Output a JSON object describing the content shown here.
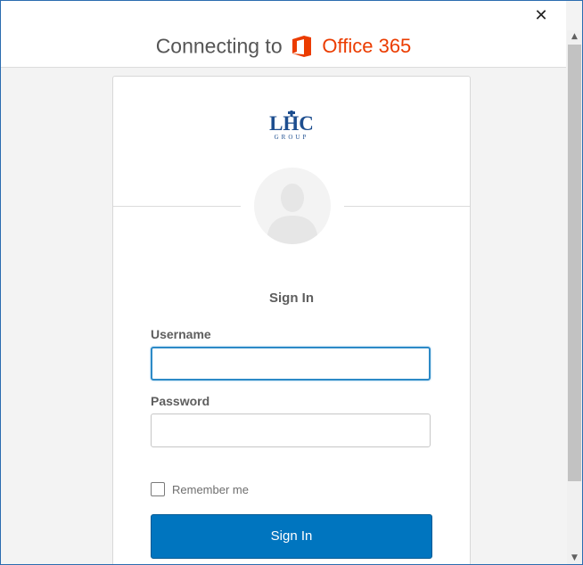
{
  "header": {
    "connecting_prefix": "Connecting to",
    "brand_name": "Office 365",
    "brand_icon": "office-logo-icon",
    "brand_color": "#eb3c00"
  },
  "window": {
    "close_glyph": "✕"
  },
  "card": {
    "logo": {
      "text": "LHC",
      "subtext": "GROUP",
      "color": "#1d4e8f"
    },
    "avatar_icon": "user-silhouette-icon",
    "title": "Sign In",
    "username": {
      "label": "Username",
      "value": "",
      "placeholder": ""
    },
    "password": {
      "label": "Password",
      "value": "",
      "placeholder": ""
    },
    "remember_me": {
      "label": "Remember me",
      "checked": false
    },
    "submit_label": "Sign In",
    "submit_color": "#0075bf"
  },
  "scrollbar": {
    "up_glyph": "▲",
    "down_glyph": "▼"
  }
}
